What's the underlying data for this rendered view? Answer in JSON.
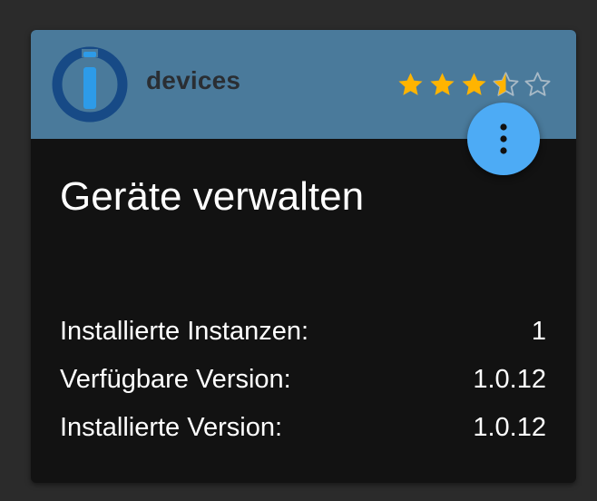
{
  "adapter": {
    "name": "devices",
    "title": "Geräte verwalten",
    "logo_icon": "iobroker-logo-icon",
    "rating": 3.5,
    "rating_max": 5,
    "menu_icon": "more-vert-icon"
  },
  "info": {
    "installed_instances_label": "Installierte Instanzen:",
    "installed_instances_value": "1",
    "available_version_label": "Verfügbare Version:",
    "available_version_value": "1.0.12",
    "installed_version_label": "Installierte Version:",
    "installed_version_value": "1.0.12"
  },
  "colors": {
    "header_bg": "#4a7a9b",
    "card_bg": "#121212",
    "page_bg": "#2b2b2b",
    "star_filled": "#ffb400",
    "star_empty_outline": "#a7b9c6",
    "fab_bg": "#4dabf5",
    "logo_ring": "#174a86",
    "logo_bar": "#2d9be8"
  }
}
